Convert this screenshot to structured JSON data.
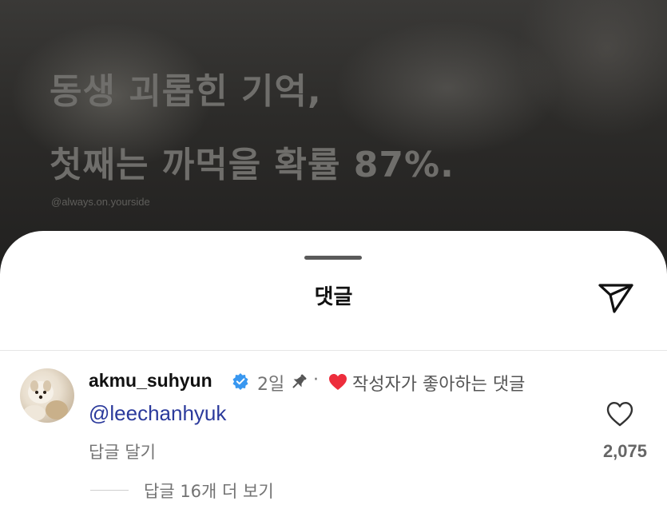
{
  "background": {
    "overlay_text_line1": "동생 괴롭힌 기억,",
    "overlay_text_line2": "첫째는 까먹을 확률 87%.",
    "watermark": "@always.on.yourside"
  },
  "sheet": {
    "title": "댓글",
    "share_icon": "paper-plane-icon"
  },
  "comment": {
    "username": "akmu_suhyun",
    "verified_icon": "verified-badge-icon",
    "time": "2일",
    "pin_icon": "pin-icon",
    "separator": "·",
    "heart_icon": "red-heart-icon",
    "liked_by_author_text": "작성자가 좋아하는 댓글",
    "text": "@leechanhyuk",
    "reply_label": "답글 달기",
    "like_count": "2,075",
    "view_replies_label": "답글 16개 더 보기"
  },
  "colors": {
    "verified": "#3897f0",
    "heart": "#ed2d3c",
    "mention": "#2b3a9c"
  }
}
